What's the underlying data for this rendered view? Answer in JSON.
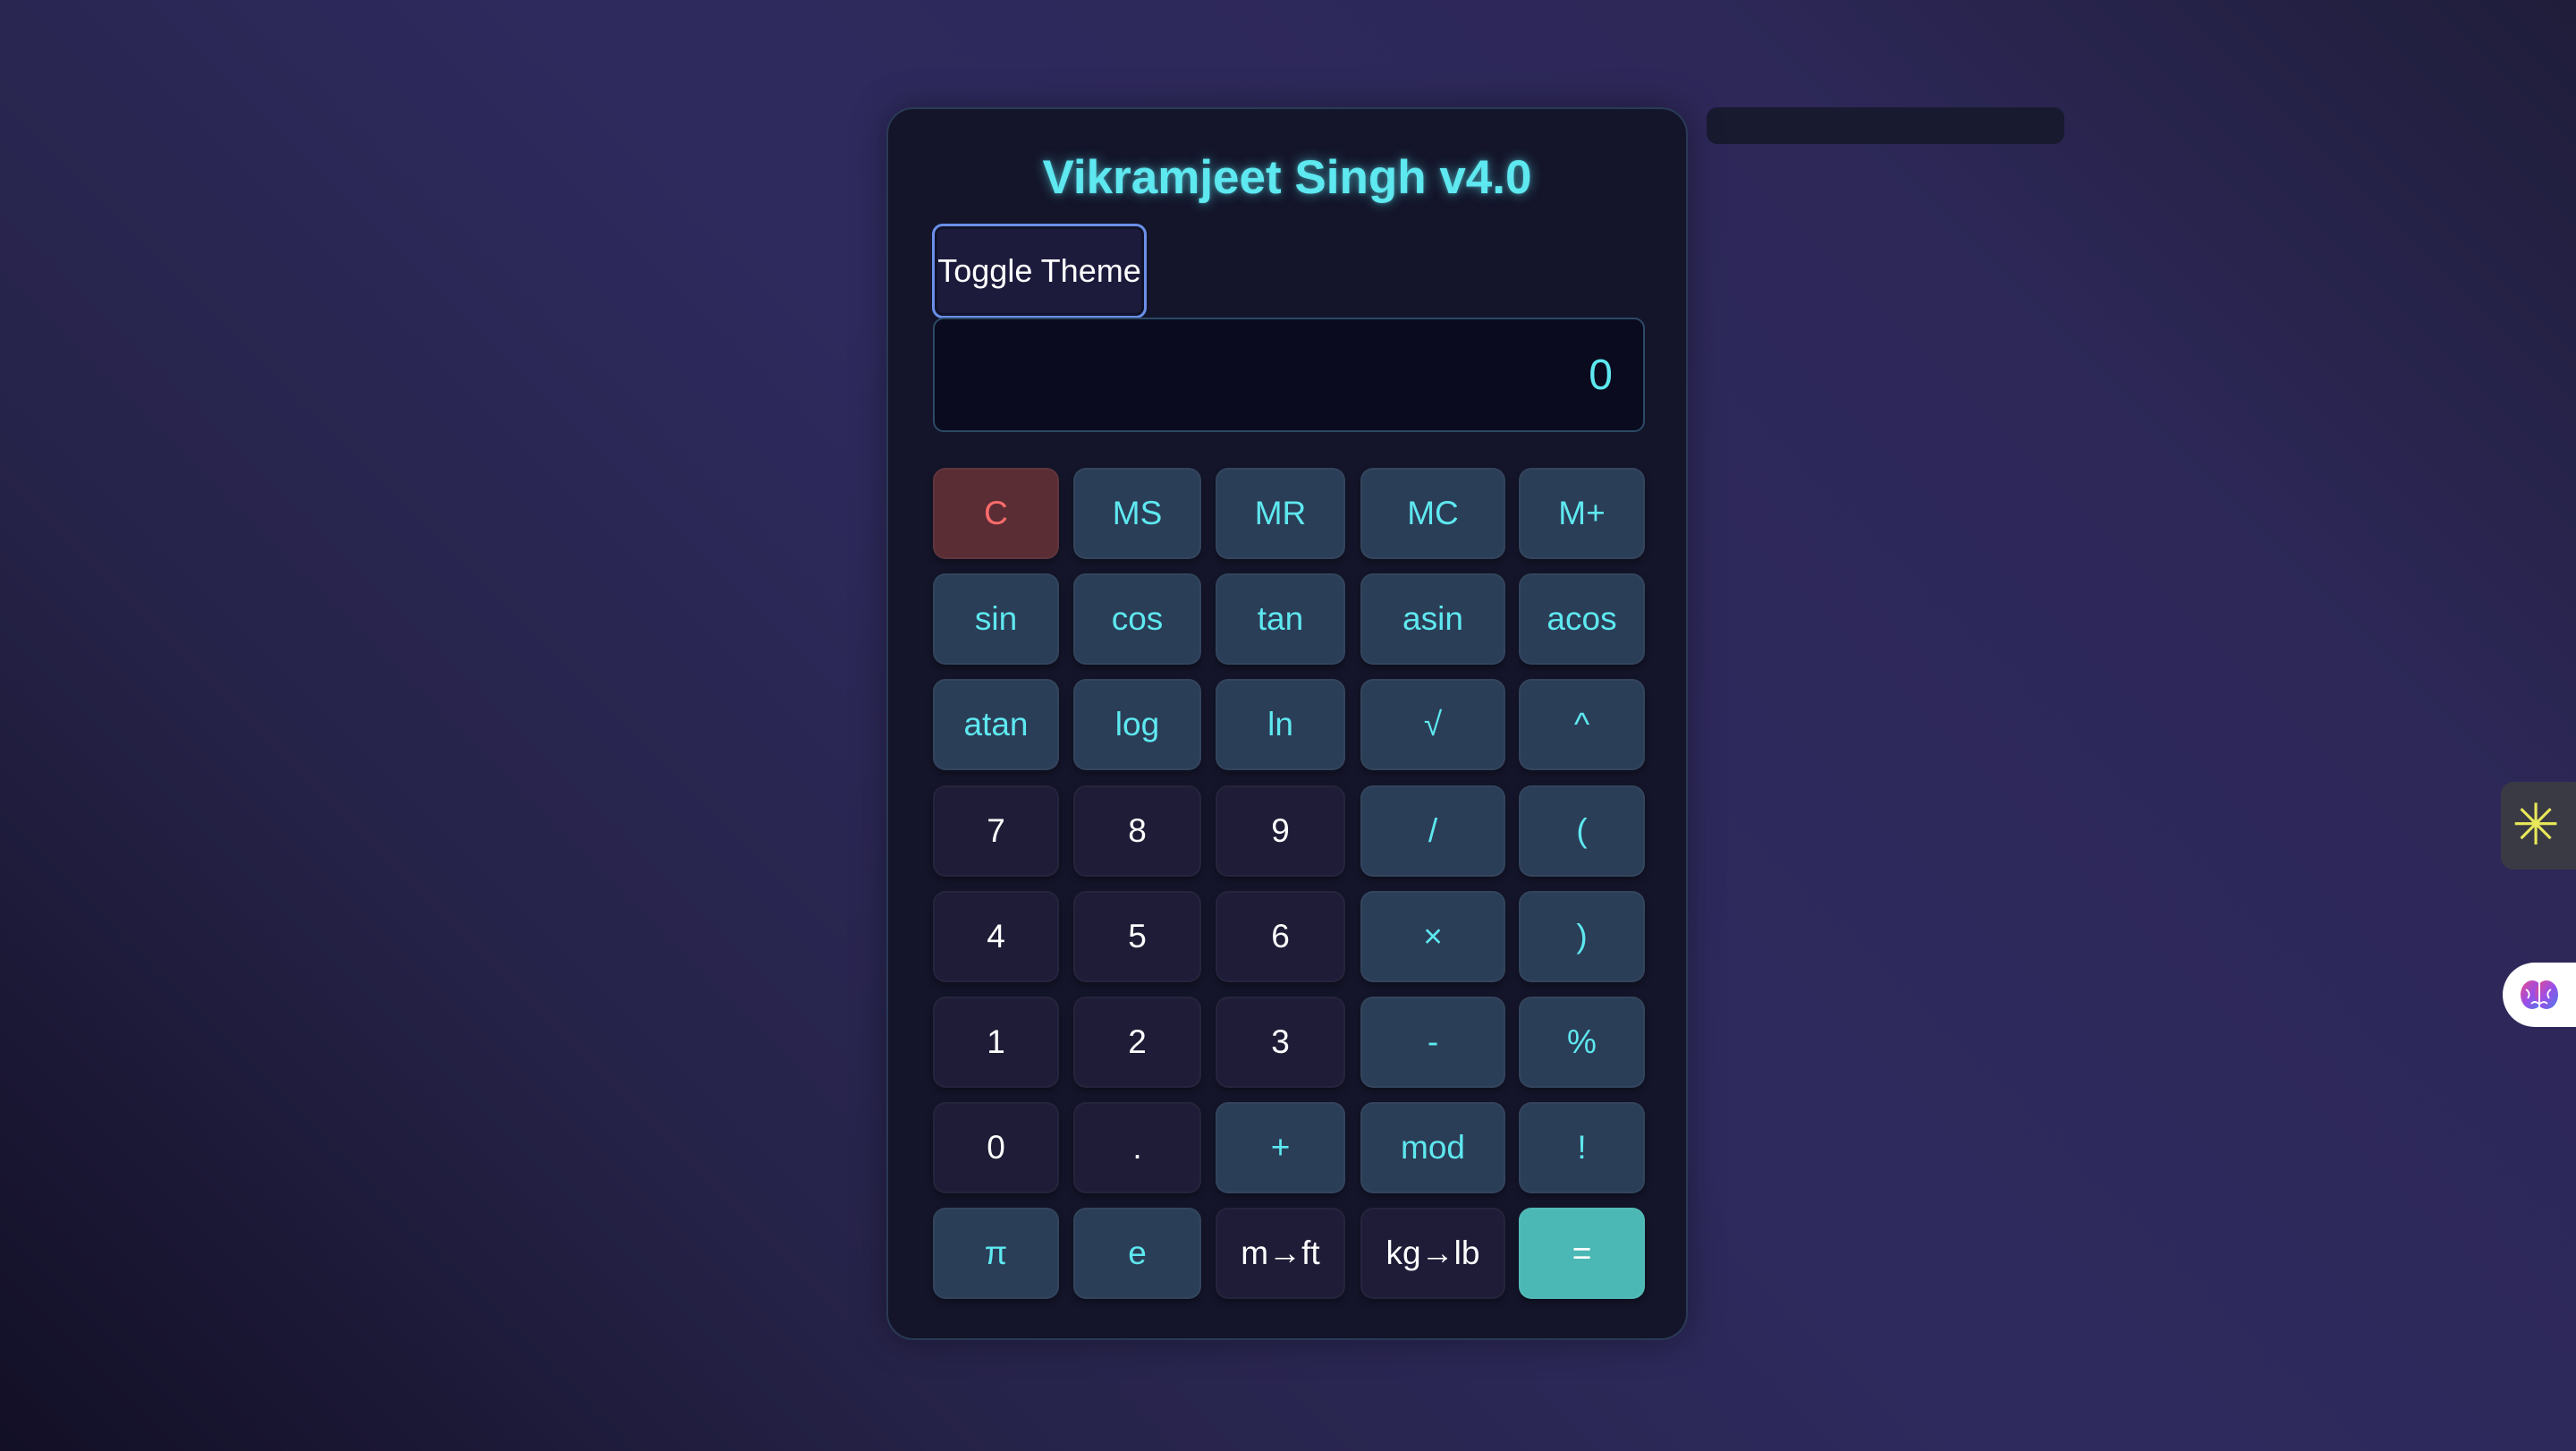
{
  "calculator": {
    "title": "Vikramjeet Singh v4.0",
    "toggle_label": "Toggle Theme",
    "display_value": "0",
    "rows": [
      [
        "C",
        "MS",
        "MR",
        "MC",
        "M+"
      ],
      [
        "sin",
        "cos",
        "tan",
        "asin",
        "acos"
      ],
      [
        "atan",
        "log",
        "ln",
        "√",
        "^"
      ],
      [
        "7",
        "8",
        "9",
        "/",
        "("
      ],
      [
        "4",
        "5",
        "6",
        "×",
        ")"
      ],
      [
        "1",
        "2",
        "3",
        "-",
        "%"
      ],
      [
        "0",
        ".",
        "+",
        "mod",
        "!"
      ],
      [
        "π",
        "e",
        "m→ft",
        "kg→lb",
        "="
      ]
    ]
  },
  "side_widgets": {
    "tab_icon": "sparkle-icon",
    "bubble_icon": "brain-icon"
  },
  "colors": {
    "accent": "#5ee8f0",
    "clear": "#ff6b6b",
    "equals": "#4cb8b5"
  }
}
